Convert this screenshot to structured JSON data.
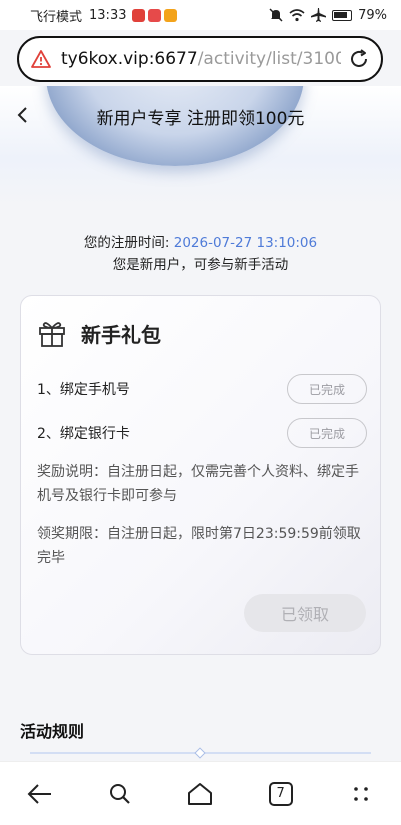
{
  "status_bar": {
    "mode": "飞行模式",
    "time": "13:33",
    "battery": "79%",
    "icons": [
      "app-red-badge",
      "app-red-badge",
      "app-orange-badge",
      "mute-icon",
      "wifi-icon",
      "airplane-icon",
      "battery-icon"
    ]
  },
  "browser": {
    "url_host": "ty6kox.vip:6677",
    "url_path": "/activity/list/3100(",
    "tabs_count": "7"
  },
  "page": {
    "title": "新用户专享 注册即领100元"
  },
  "registration": {
    "label": "您的注册时间:",
    "time": "2026-07-27 13:10:06",
    "note": "您是新用户，可参与新手活动"
  },
  "card": {
    "title": "新手礼包",
    "tasks": [
      {
        "label": "1、绑定手机号",
        "status": "已完成"
      },
      {
        "label": "2、绑定银行卡",
        "status": "已完成"
      }
    ],
    "reward_desc": "奖励说明：自注册日起，仅需完善个人资料、绑定手机号及银行卡即可参与",
    "deadline_desc": "领奖期限：自注册日起，限时第7日23:59:59前领取完毕",
    "claim_label": "已领取"
  },
  "rules": {
    "title": "活动规则"
  },
  "colors": {
    "accent_blue": "#4f7bd8",
    "warn_red": "#e0413a"
  }
}
